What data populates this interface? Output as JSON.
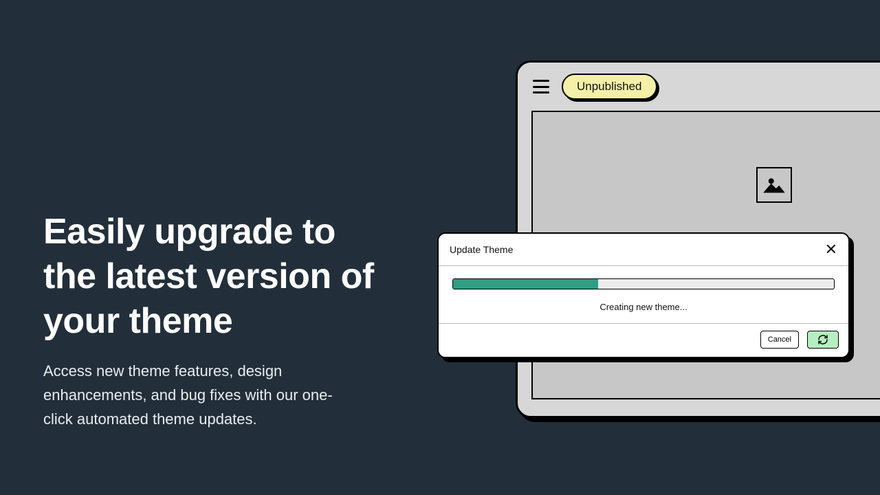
{
  "hero": {
    "headline": "Easily upgrade to the latest version of your theme",
    "subcopy": "Access new theme features, design enhancements, and bug fixes with our one-click automated theme updates."
  },
  "app": {
    "status_label": "Unpublished"
  },
  "dialog": {
    "title": "Update Theme",
    "progress_text": "Creating new theme...",
    "progress_percent": 38,
    "cancel_label": "Cancel"
  }
}
